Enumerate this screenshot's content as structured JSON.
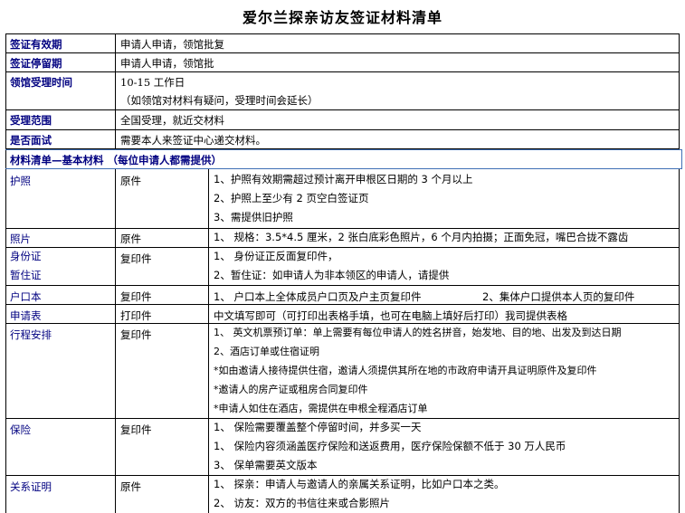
{
  "title": "爱尔兰探亲访友签证材料清单",
  "info_rows": [
    {
      "label": "签证有效期",
      "value": "申请人申请，领馆批复"
    },
    {
      "label": "签证停留期",
      "value": "申请人申请，领馆批"
    },
    {
      "label": "领馆受理时间",
      "value": "10-15 工作日",
      "value2": "（如领馆对材料有疑问，受理时间会延长）"
    },
    {
      "label": "受理范围",
      "value": "全国受理，就近交材料"
    },
    {
      "label": "是否面试",
      "value": "需要本人来签证中心递交材料。"
    }
  ],
  "section_title": "材料清单—基本材料 （每位申请人都需提供）",
  "materials": [
    {
      "name": "护照",
      "type": "原件",
      "lines": [
        "1、护照有效期需超过预计离开申根区日期的 3 个月以上",
        "2、护照上至少有 2 页空白签证页",
        "3、需提供旧护照"
      ]
    },
    {
      "name": "照片",
      "type": "原件",
      "lines": [
        "1、 规格：3.5*4.5 厘米，2 张白底彩色照片，6 个月内拍摄；正面免冠，嘴巴合拢不露齿"
      ]
    },
    {
      "name": "身份证",
      "name2": "暂住证",
      "type": "复印件",
      "lines": [
        "1、 身份证正反面复印件，",
        "2、暂住证：如申请人为非本领区的申请人，请提供"
      ]
    },
    {
      "name": "户口本",
      "type": "复印件",
      "lines": [
        "1、 户口本上全体成员户口页及户主页复印件",
        "2、集体户口提供本人页的复印件"
      ]
    },
    {
      "name": "申请表",
      "type": "打印件",
      "lines": [
        "中文填写即可（可打印出表格手填，也可在电脑上填好后打印）我司提供表格"
      ]
    },
    {
      "name": "行程安排",
      "type": "复印件",
      "lines": [
        "1、 英文机票预订单：单上需要有每位申请人的姓名拼音，始发地、目的地、出发及到达日期",
        "2、酒店订单或住宿证明",
        "*如由邀请人接待提供住宿，邀请人须提供其所在地的市政府申请开具证明原件及复印件",
        "*邀请人的房产证或租房合同复印件",
        "*申请人如住在酒店，需提供在申根全程酒店订单"
      ]
    },
    {
      "name": "保险",
      "type": "复印件",
      "lines": [
        "1、 保险需要覆盖整个停留时间，并多买一天",
        "1、 保险内容须涵盖医疗保险和送返费用，医疗保险保额不低于 30 万人民币",
        "3、 保单需要英文版本"
      ]
    },
    {
      "name": "关系证明",
      "type": "原件",
      "lines": [
        "1、 探亲：申请人与邀请人的亲属关系证明，比如户口本之类。",
        "2、 访友：双方的书信往来或合影照片"
      ]
    }
  ]
}
